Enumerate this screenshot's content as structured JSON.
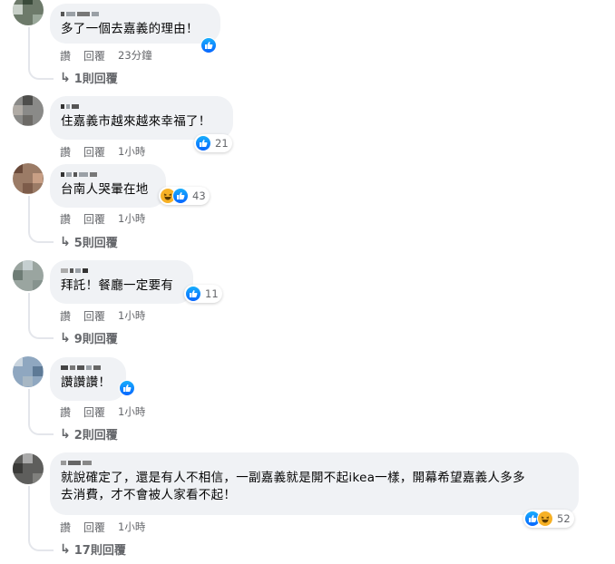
{
  "actions": {
    "like": "讚",
    "reply": "回覆"
  },
  "comments": [
    {
      "text": "多了一個去嘉義的理由！",
      "time": "23分鐘",
      "reactions": [
        "like"
      ],
      "count": "",
      "replies": "1則回覆"
    },
    {
      "text": "住嘉義市越來越來幸福了！",
      "time": "1小時",
      "reactions": [
        "like"
      ],
      "count": "21",
      "replies": ""
    },
    {
      "text": "台南人哭暈在地",
      "time": "1小時",
      "reactions": [
        "haha",
        "like"
      ],
      "count": "43",
      "replies": "5則回覆"
    },
    {
      "text": "拜託！餐廳一定要有",
      "time": "1小時",
      "reactions": [
        "like"
      ],
      "count": "11",
      "replies": "9則回覆"
    },
    {
      "text": "讚讚讚！",
      "time": "1小時",
      "reactions": [
        "like"
      ],
      "count": "",
      "replies": "2則回覆"
    },
    {
      "text": "就說確定了，還是有人不相信，一副嘉義就是開不起ikea一樣，開幕希望嘉義人多多\n去消費，才不會被人家看不起！",
      "time": "1小時",
      "reactions": [
        "like",
        "haha"
      ],
      "count": "52",
      "replies": "17則回覆"
    }
  ],
  "icons": {
    "like": "thumbs-up-icon",
    "haha": "laughing-face-icon",
    "reply_arrow": "reply-arrow-icon"
  },
  "colors": {
    "like_blue": "#0866ff",
    "haha_yellow": "#f7b125",
    "bubble_bg": "#f0f2f5",
    "meta_gray": "#65676b"
  }
}
